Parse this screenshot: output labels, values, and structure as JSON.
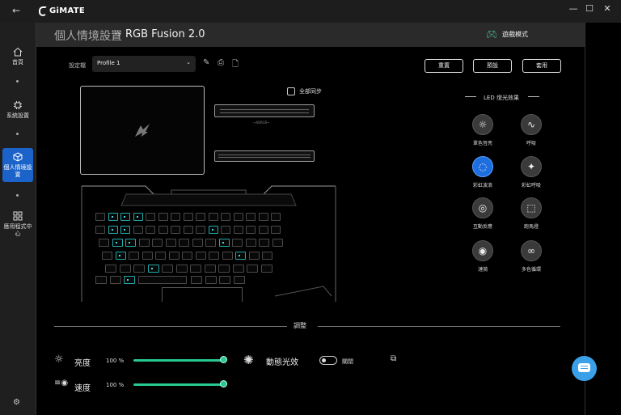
{
  "app": {
    "name": "GiMATE",
    "back_icon": "←",
    "win_min": "—",
    "win_max": "☐",
    "win_close": "✕"
  },
  "sidebar": {
    "items": [
      {
        "label": "首頁",
        "icon": "home-icon"
      },
      {
        "label": "系統設置",
        "icon": "chip-icon"
      },
      {
        "label": "個人情境設置",
        "icon": "cube-icon"
      },
      {
        "label": "應用程式中心",
        "icon": "apps-grid-icon"
      }
    ],
    "settings_icon": "⚙"
  },
  "header": {
    "breadcrumb_parent": "個人情境設置",
    "breadcrumb_sep": "›",
    "breadcrumb_current": "RGB Fusion 2.0",
    "game_mode_label": "遊戲模式"
  },
  "profile": {
    "label": "設定檔",
    "value": "Profile 1"
  },
  "actions": {
    "reset": "重置",
    "preset": "預設",
    "apply": "套用"
  },
  "sync": {
    "label": "全部同步"
  },
  "laptop": {
    "side_tag": "~AORUS~"
  },
  "effects": {
    "title": "LED 燈光效果",
    "items": [
      {
        "label": "單色恆亮",
        "icon": "sun-icon",
        "glyph": "☼",
        "selected": false
      },
      {
        "label": "呼吸",
        "icon": "wave-icon",
        "glyph": "∿",
        "selected": false
      },
      {
        "label": "彩虹波浪",
        "icon": "rainbow-circle-icon",
        "glyph": "◌",
        "selected": true
      },
      {
        "label": "彩虹呼吸",
        "icon": "sparkle-icon",
        "glyph": "✦",
        "selected": false
      },
      {
        "label": "互動反應",
        "icon": "touch-icon",
        "glyph": "◎",
        "selected": false
      },
      {
        "label": "跑馬燈",
        "icon": "marquee-icon",
        "glyph": "⬚",
        "selected": false
      },
      {
        "label": "漣漪",
        "icon": "ripple-icon",
        "glyph": "◉",
        "selected": false
      },
      {
        "label": "多色循環",
        "icon": "cycle-icon",
        "glyph": "∞",
        "selected": false
      }
    ]
  },
  "adjust": {
    "title": "調整",
    "brightness": {
      "label": "亮度",
      "value": "100 %",
      "level": 1.0
    },
    "speed": {
      "label": "速度",
      "value": "100 %",
      "level": 1.0
    },
    "dynamic": {
      "label": "動態光效",
      "state": "關閉"
    }
  },
  "colors": {
    "accent": "#27c98e",
    "selected": "#1d6fe0",
    "nav_active": "#1b63c9"
  }
}
